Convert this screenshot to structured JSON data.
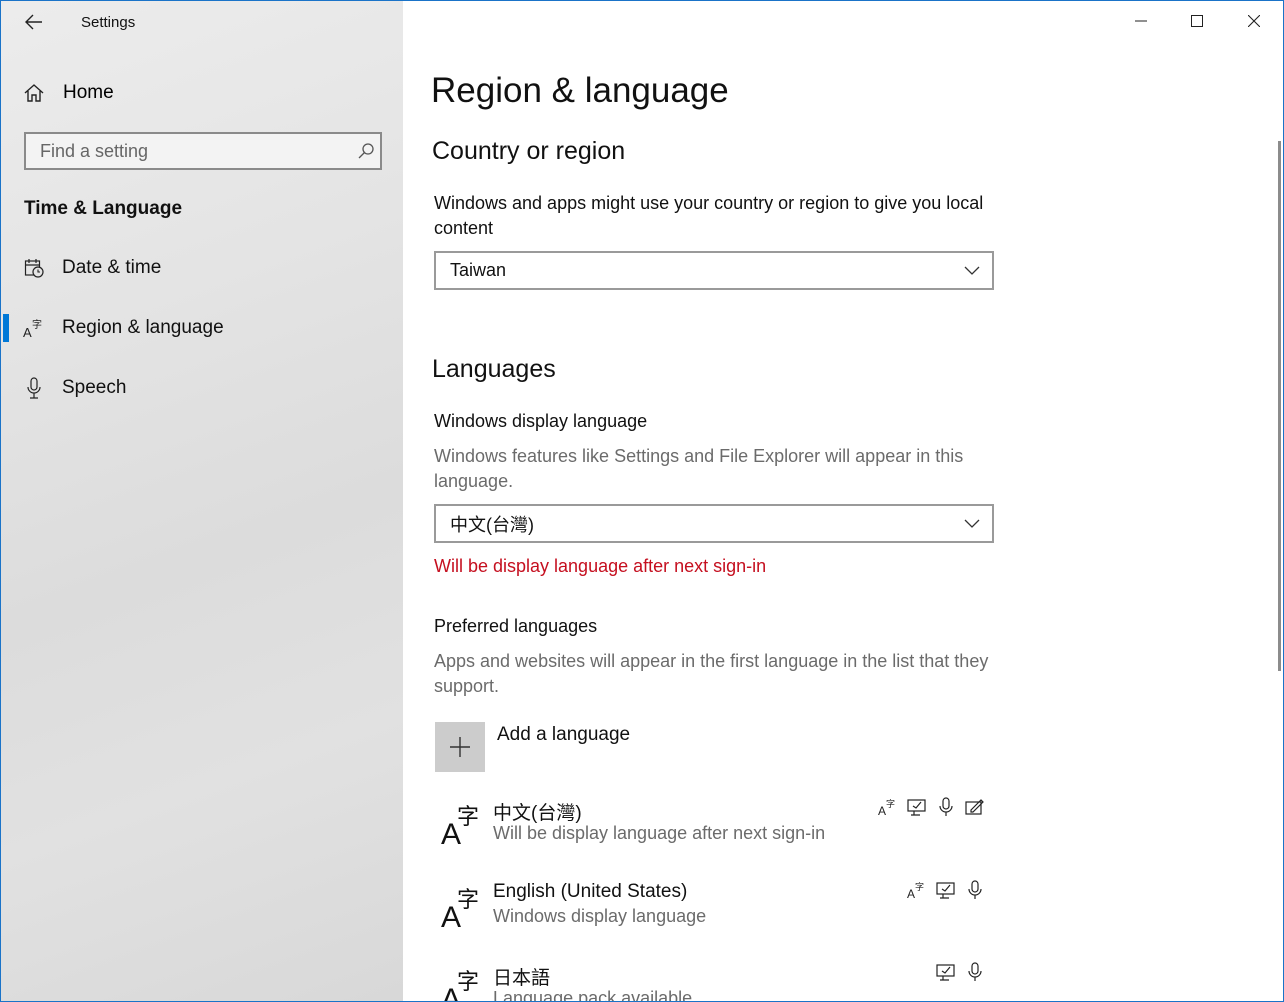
{
  "window": {
    "title": "Settings"
  },
  "sidebar": {
    "home_label": "Home",
    "search_placeholder": "Find a setting",
    "section_label": "Time & Language",
    "items": [
      {
        "label": "Date & time",
        "icon": "calendar-clock-icon",
        "active": false
      },
      {
        "label": "Region & language",
        "icon": "language-icon",
        "active": true
      },
      {
        "label": "Speech",
        "icon": "microphone-icon",
        "active": false
      }
    ]
  },
  "main": {
    "page_title": "Region & language",
    "country": {
      "heading": "Country or region",
      "description": "Windows and apps might use your country or region to give you local content",
      "selected": "Taiwan"
    },
    "languages": {
      "heading": "Languages",
      "display_language_label": "Windows display language",
      "display_language_desc": "Windows features like Settings and File Explorer will appear in this language.",
      "display_language_selected": "中文(台灣)",
      "warning": "Will be display language after next sign-in",
      "preferred_label": "Preferred languages",
      "preferred_desc": "Apps and websites will appear in the first language in the list that they support.",
      "add_language_label": "Add a language",
      "list": [
        {
          "name": "中文(台灣)",
          "status": "Will be display language after next sign-in",
          "capabilities": [
            "language-pack-icon",
            "text-to-speech-icon",
            "speech-icon",
            "handwriting-icon"
          ]
        },
        {
          "name": "English (United States)",
          "status": "Windows display language",
          "capabilities": [
            "language-pack-icon",
            "text-to-speech-icon",
            "speech-icon"
          ]
        },
        {
          "name": "日本語",
          "status": "Language pack available",
          "capabilities": [
            "text-to-speech-icon",
            "speech-icon"
          ]
        }
      ]
    }
  },
  "colors": {
    "accent": "#0078d7",
    "warning": "#c50f1f",
    "sidebar_bg": "#e4e4e4"
  }
}
